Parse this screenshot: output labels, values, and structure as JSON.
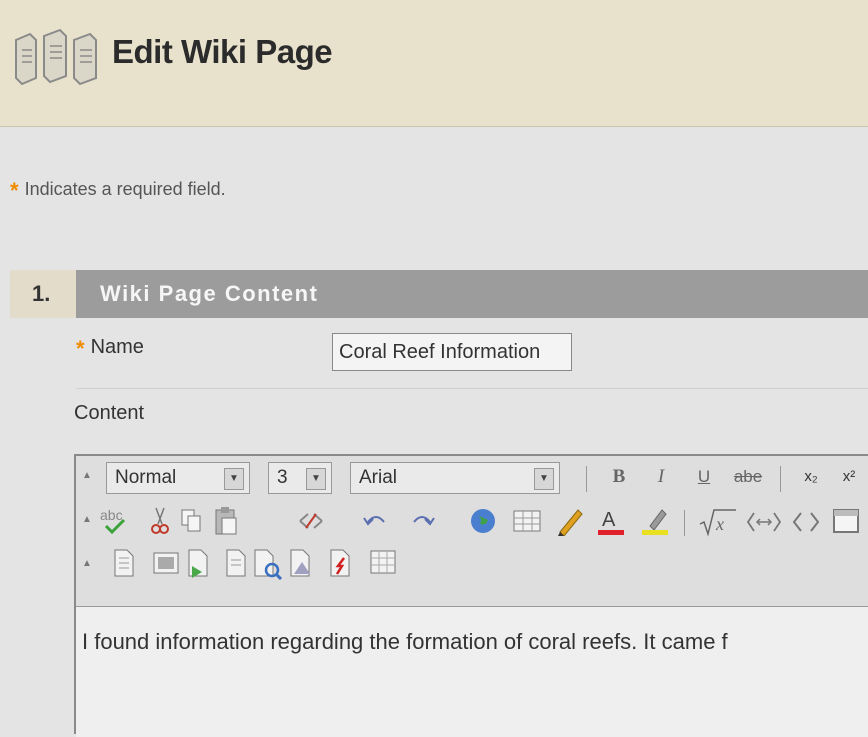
{
  "header": {
    "title": "Edit Wiki Page"
  },
  "required_note": {
    "star": "*",
    "text": "Indicates a required field."
  },
  "section": {
    "number": "1.",
    "title": "Wiki Page Content"
  },
  "form": {
    "name_star": "*",
    "name_label": "Name",
    "name_value": "Coral Reef Information",
    "content_label": "Content"
  },
  "editor": {
    "format_select": "Normal",
    "size_select": "3",
    "font_select": "Arial",
    "bold": "B",
    "italic": "I",
    "underline": "U",
    "strike": "abe",
    "subscript": "x₂",
    "superscript": "x²",
    "body_text": "I found information regarding the formation of coral reefs. It came f"
  },
  "colors": {
    "accent_star": "#f08c00",
    "section_bar": "#9c9c9c",
    "header_bg": "#e8e2cc"
  },
  "icons": [
    "wiki-logo-icon",
    "spellcheck-icon",
    "cut-icon",
    "copy-icon",
    "paste-icon",
    "link-remove-icon",
    "undo-icon",
    "redo-icon",
    "globe-icon",
    "table-icon",
    "pencil-icon",
    "font-color-icon",
    "highlight-icon",
    "math-icon",
    "code-icon",
    "html-icon",
    "preview-icon",
    "mashup-icon"
  ]
}
